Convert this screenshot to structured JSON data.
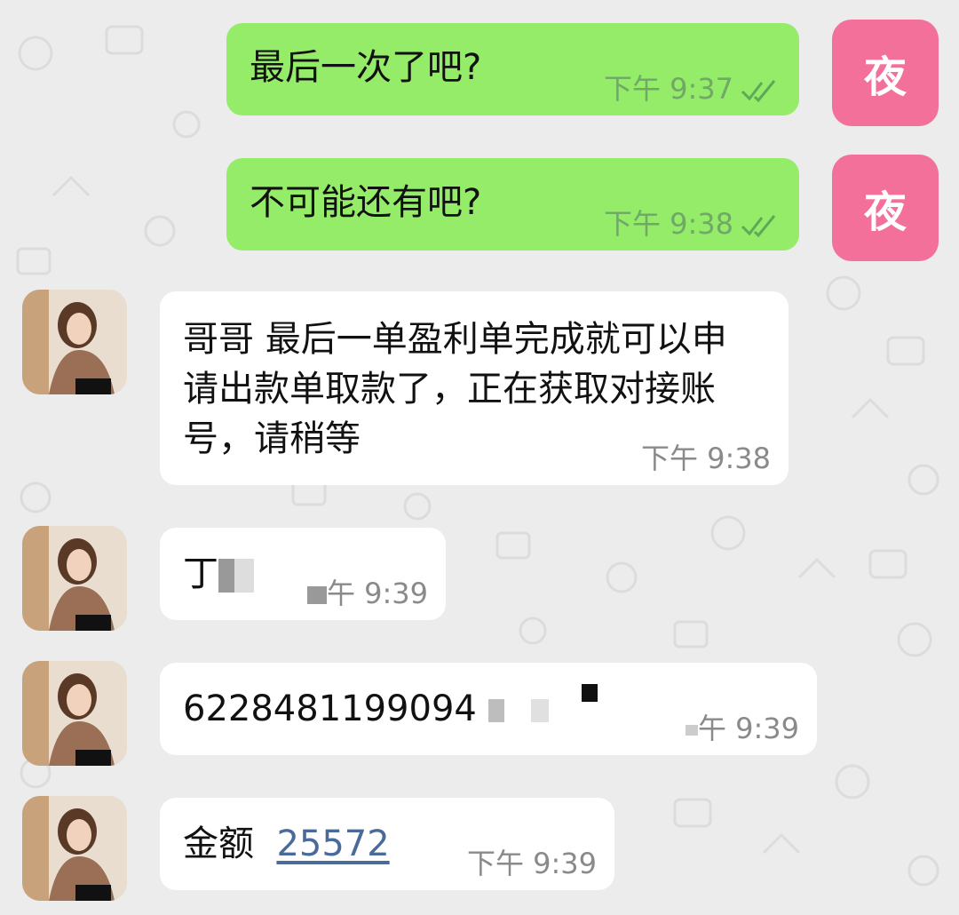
{
  "chat": {
    "self_avatar_text": "夜",
    "messages": [
      {
        "text": "最后一次了吧?",
        "time": "下午 9:37",
        "read": true
      },
      {
        "text": "不可能还有吧?",
        "time": "下午 9:38",
        "read": true
      },
      {
        "text": "哥哥  最后一单盈利单完成就可以申请出款单取款了，正在获取对接账号，请稍等",
        "time": "下午 9:38"
      },
      {
        "text": "丁",
        "time": "午 9:39"
      },
      {
        "text": "6228481199094",
        "time": "午 9:39"
      },
      {
        "label": "金额",
        "amount": "25572",
        "time": "下午 9:39"
      }
    ]
  },
  "colors": {
    "sent_bubble": "#95ec69",
    "recv_bubble": "#ffffff",
    "self_avatar": "#f2709a",
    "background": "#ececec"
  }
}
